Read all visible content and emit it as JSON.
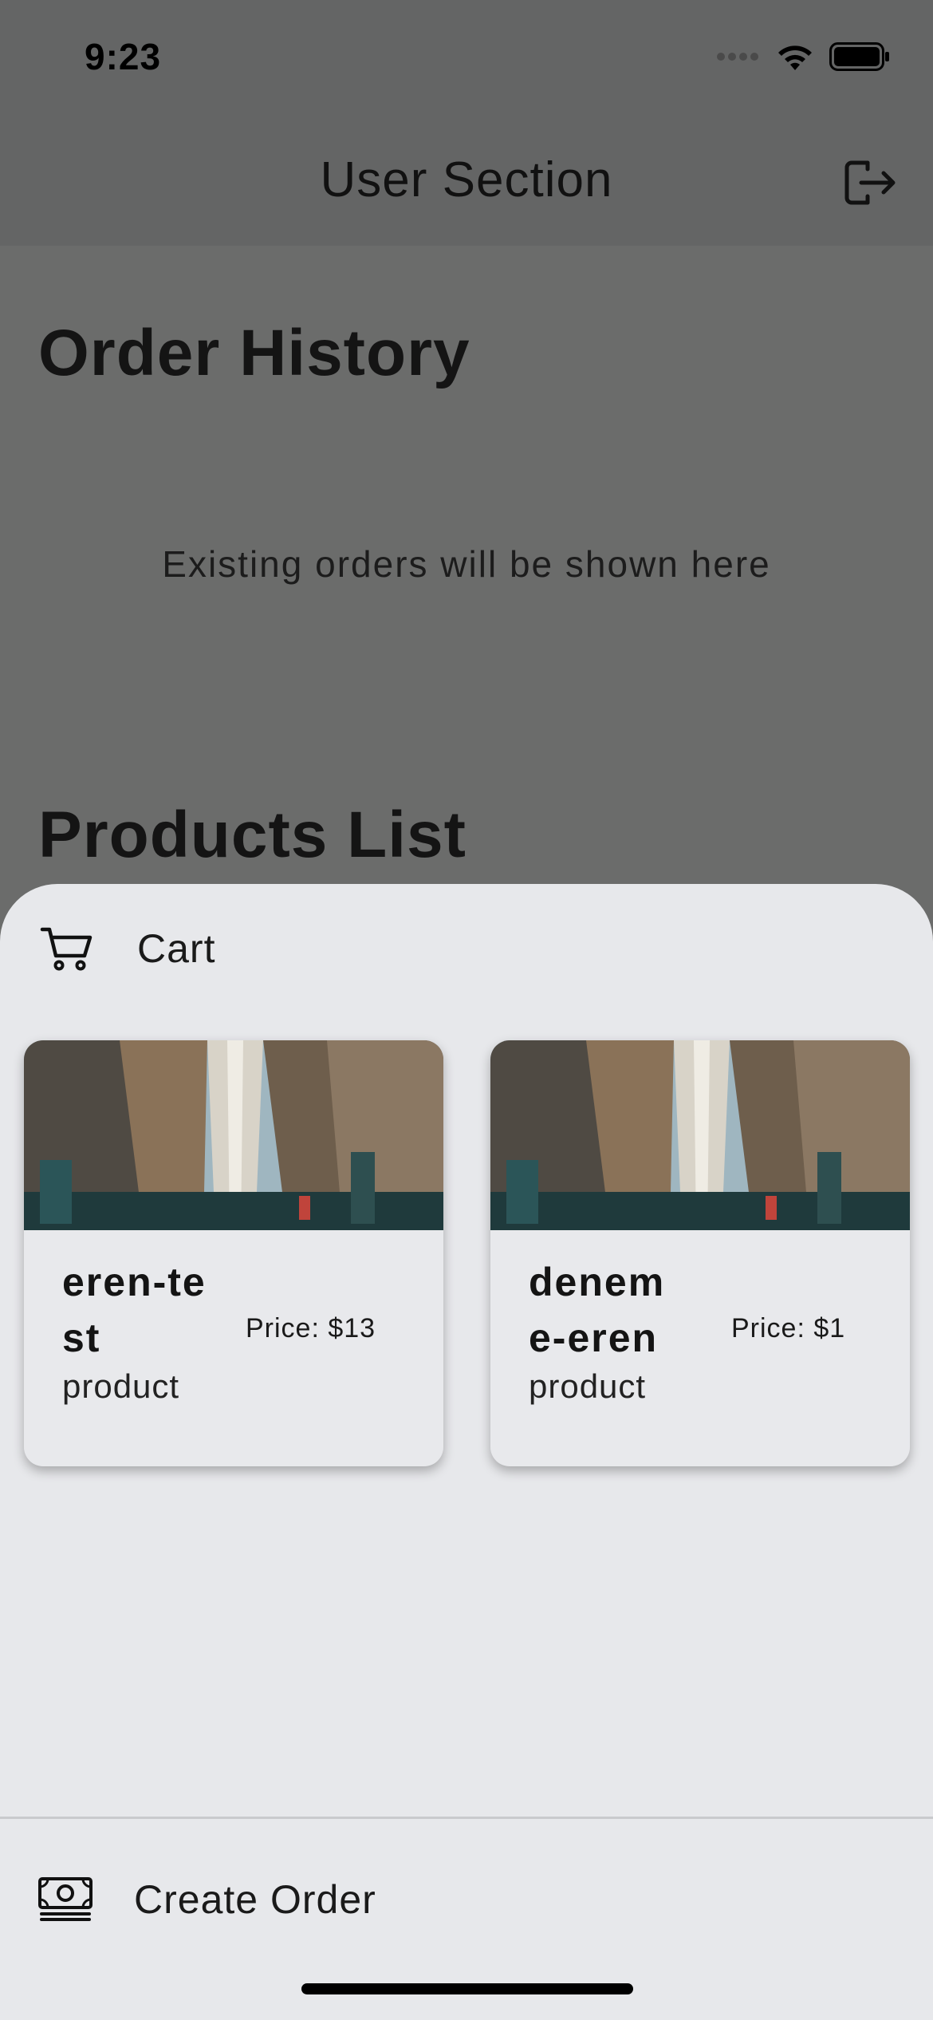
{
  "status_bar": {
    "time": "9:23",
    "signal_icon": "signal-dots-icon",
    "wifi_icon": "wifi-icon",
    "battery_icon": "battery-icon"
  },
  "app_bar": {
    "title": "User Section",
    "logout_icon": "logout-icon"
  },
  "order_history": {
    "title": "Order History",
    "empty_message": "Existing orders will be shown here"
  },
  "products_list": {
    "title": "Products List"
  },
  "cart": {
    "label": "Cart",
    "icon": "cart-icon",
    "products": [
      {
        "name": "eren-test",
        "type": "product",
        "price": "Price: $13",
        "image": "city-street-photo"
      },
      {
        "name": "deneme-eren",
        "type": "product",
        "price": "Price: $1",
        "image": "city-street-photo"
      }
    ]
  },
  "actions": {
    "create_order_label": "Create Order",
    "create_order_icon": "money-icon"
  },
  "colors": {
    "overlay": "#6b6c6b",
    "sheet": "#e7e8eb",
    "text": "#111111"
  }
}
